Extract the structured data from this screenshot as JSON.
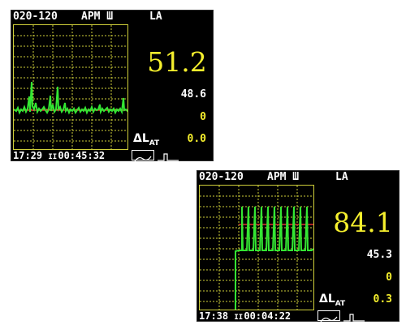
{
  "screens": [
    {
      "range": "020-120",
      "mode": "APM Ш",
      "weighting": "LA",
      "main_value": "51.2",
      "value_1": "48.6",
      "value_2": "0",
      "dlat_label": "ΔL",
      "dlat_sub": "AT",
      "dlat_value": "0.0",
      "time_1": "17:29",
      "pause_glyph": "II",
      "time_2": "00:45:32",
      "icons": [
        "waveform-icon",
        "pulse-icon"
      ]
    },
    {
      "range": "020-120",
      "mode": "APM Ш",
      "weighting": "LA",
      "main_value": "84.1",
      "value_1": "45.3",
      "value_2": "0",
      "dlat_label": "ΔL",
      "dlat_sub": "AT",
      "dlat_value": "0.3",
      "time_1": "17:38",
      "pause_glyph": "II",
      "time_2": "00:04:22",
      "icons": [
        "waveform-icon",
        "pulse-icon"
      ]
    }
  ],
  "colors": {
    "background": "#000000",
    "trace": "#33e633",
    "reference_line": "#e03030",
    "grid": "#cfcf3a",
    "main_value": "#f5ef2d",
    "text": "#ffffff"
  }
}
